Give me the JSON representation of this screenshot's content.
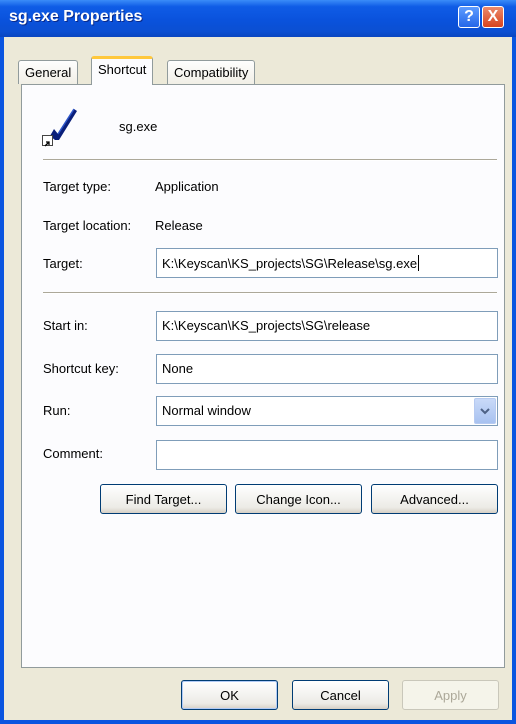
{
  "window": {
    "title": "sg.exe Properties"
  },
  "titlebar": {
    "help_label": "?",
    "close_label": "X"
  },
  "tabs": [
    {
      "label": "General"
    },
    {
      "label": "Shortcut",
      "active": true
    },
    {
      "label": "Compatibility"
    }
  ],
  "shortcut": {
    "file_name": "sg.exe",
    "target_type_label": "Target type:",
    "target_type_value": "Application",
    "target_location_label": "Target location:",
    "target_location_value": "Release",
    "target_label": "Target:",
    "target_value": "K:\\Keyscan\\KS_projects\\SG\\Release\\sg.exe",
    "start_in_label": "Start in:",
    "start_in_value": "K:\\Keyscan\\KS_projects\\SG\\release",
    "shortcut_key_label": "Shortcut key:",
    "shortcut_key_value": "None",
    "run_label": "Run:",
    "run_value": "Normal window",
    "comment_label": "Comment:",
    "comment_value": "",
    "find_target_label": "Find Target...",
    "change_icon_label": "Change Icon...",
    "advanced_label": "Advanced..."
  },
  "footer": {
    "ok_label": "OK",
    "cancel_label": "Cancel",
    "apply_label": "Apply"
  },
  "colors": {
    "titlebar": "#0a52dc",
    "close": "#d8431e",
    "active_tab_highlight": "#ffc83c",
    "dialog_bg": "#ece9d8"
  },
  "icons": [
    "help-icon",
    "close-icon",
    "app-icon",
    "shortcut-arrow-icon",
    "dropdown-arrow-icon"
  ]
}
